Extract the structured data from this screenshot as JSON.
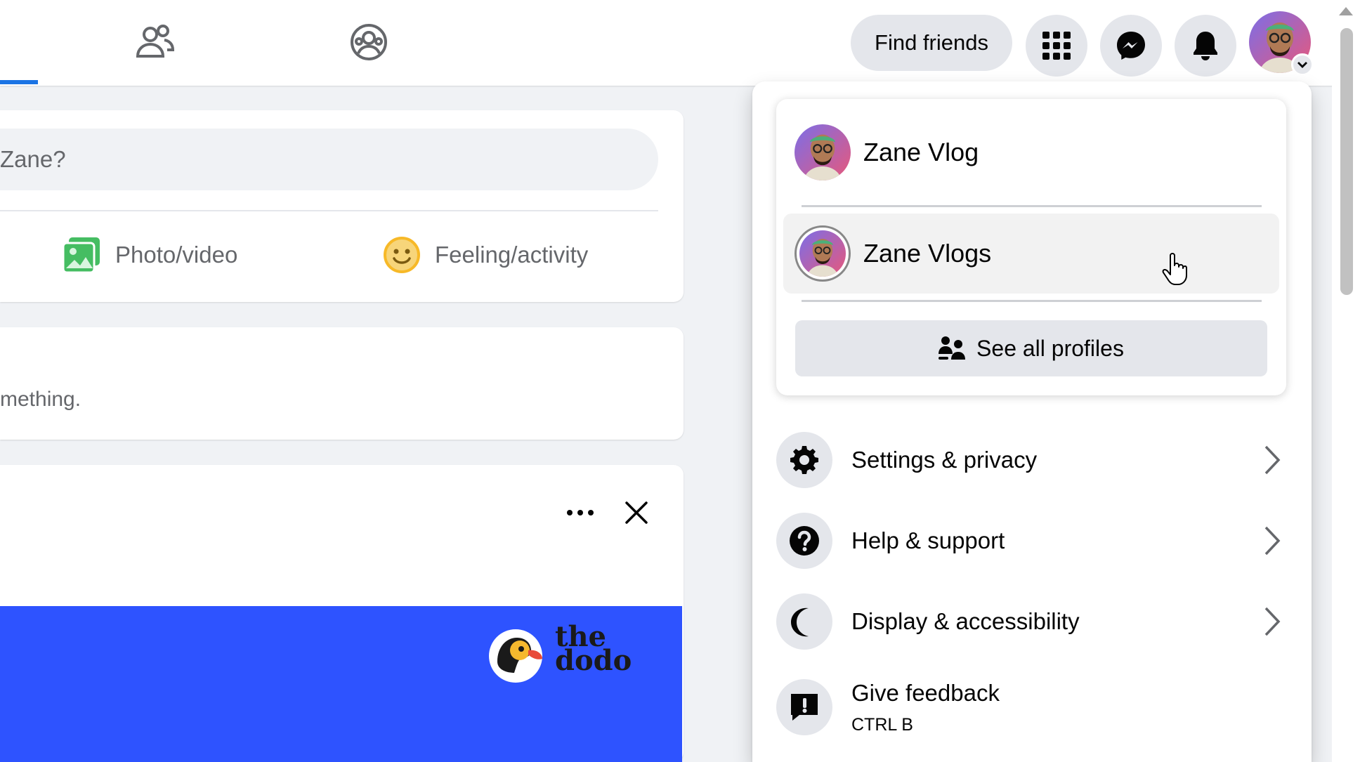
{
  "topbar": {
    "find_friends_label": "Find friends",
    "nav_icons": [
      "friends-icon",
      "groups-icon"
    ],
    "buttons": [
      "menu-grid-icon",
      "messenger-icon",
      "notifications-bell-icon",
      "account-avatar"
    ],
    "accent_color": "#1b74e4"
  },
  "feed": {
    "composer_placeholder": "Zane?",
    "composer_actions": [
      {
        "label": "Photo/video",
        "icon": "photo-video-icon",
        "color": "#45bd62"
      },
      {
        "label": "Feeling/activity",
        "icon": "feeling-activity-icon",
        "color": "#f7b928"
      }
    ],
    "empty_card_text": "mething.",
    "ad_card": {
      "brand_line1": "the",
      "brand_line2": "dodo",
      "banner_color": "#2e53ff"
    }
  },
  "dropdown": {
    "profiles": [
      {
        "name": "Zane Vlog",
        "type": "personal"
      },
      {
        "name": "Zane Vlogs",
        "type": "page",
        "hovered": true
      }
    ],
    "see_all_label": "See all profiles",
    "menu": [
      {
        "label": "Settings & privacy",
        "icon": "gear-icon",
        "has_chevron": true
      },
      {
        "label": "Help & support",
        "icon": "question-icon",
        "has_chevron": true
      },
      {
        "label": "Display & accessibility",
        "icon": "moon-icon",
        "has_chevron": true
      },
      {
        "label": "Give feedback",
        "sublabel": "CTRL B",
        "icon": "feedback-icon",
        "has_chevron": false
      }
    ]
  }
}
